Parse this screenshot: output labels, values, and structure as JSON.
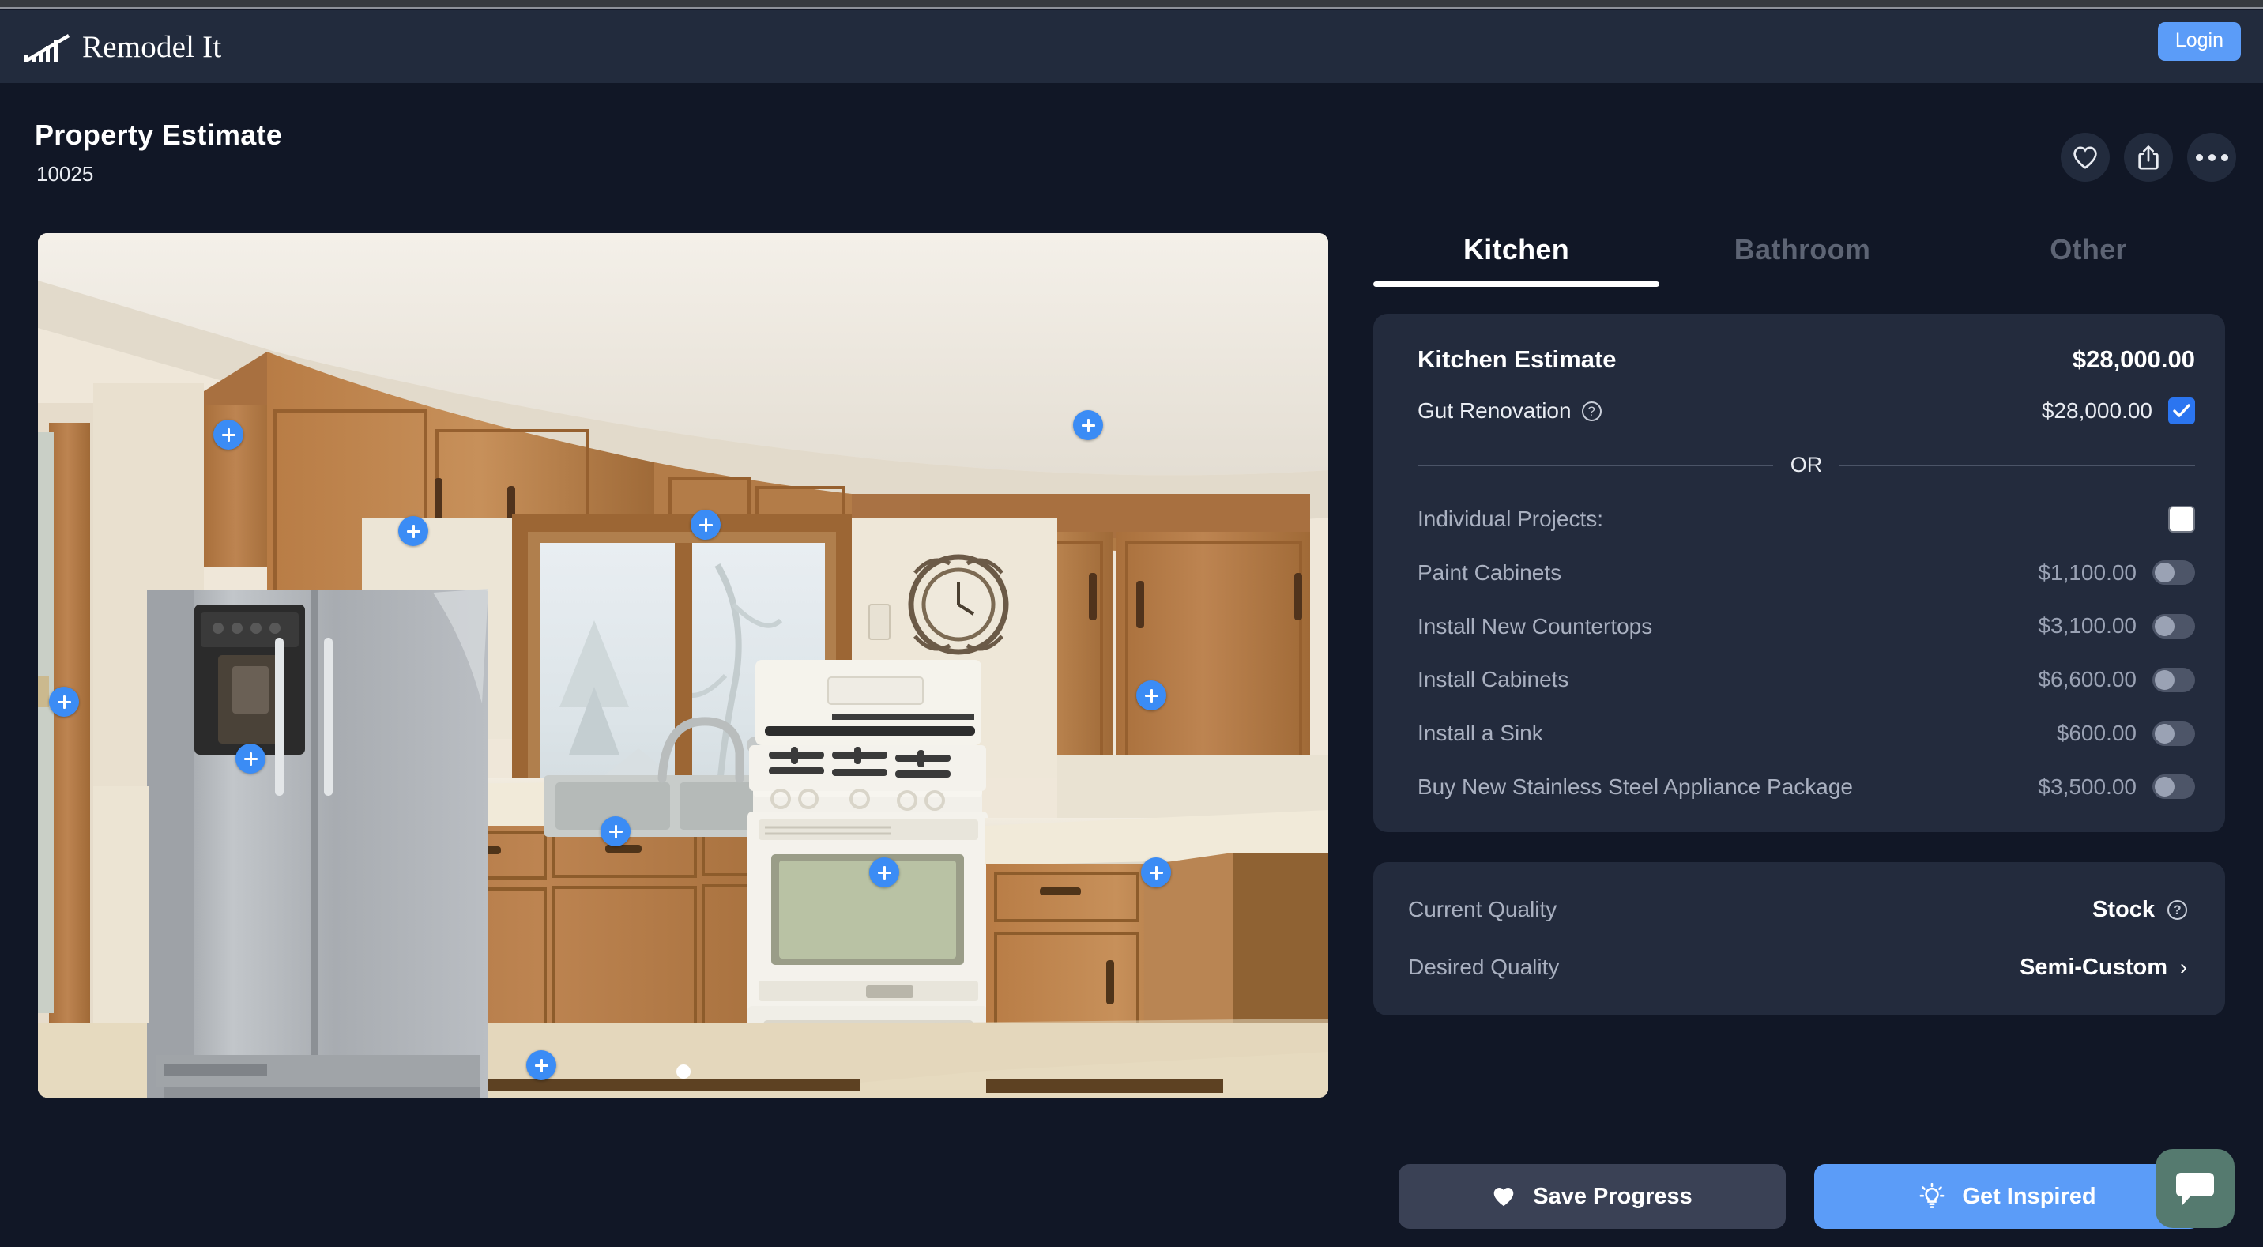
{
  "header": {
    "logo_text": "Remodel It",
    "logo_icon": "bar-chart-trend-icon",
    "login_label": "Login"
  },
  "page": {
    "title": "Property Estimate",
    "subtitle": "10025"
  },
  "actions": [
    {
      "name": "favorite",
      "icon": "heart-icon"
    },
    {
      "name": "share",
      "icon": "share-icon"
    },
    {
      "name": "more",
      "icon": "ellipsis-icon"
    }
  ],
  "photo": {
    "alt": "Kitchen interior with oak cabinets, stainless refrigerator and white gas range",
    "hotspot_count": 10,
    "carousel_dots": 1,
    "current_slide": 1
  },
  "tabs": [
    {
      "label": "Kitchen",
      "active": true
    },
    {
      "label": "Bathroom",
      "active": false
    },
    {
      "label": "Other",
      "active": false
    }
  ],
  "estimate_card": {
    "title": "Kitchen Estimate",
    "total": "$28,000.00",
    "gut": {
      "label": "Gut Renovation",
      "help_glyph": "?",
      "price": "$28,000.00",
      "checked": true
    },
    "or_text": "OR",
    "individual_label": "Individual Projects:",
    "individual_checked": false,
    "projects": [
      {
        "label": "Paint Cabinets",
        "price": "$1,100.00",
        "on": false
      },
      {
        "label": "Install New Countertops",
        "price": "$3,100.00",
        "on": false
      },
      {
        "label": "Install Cabinets",
        "price": "$6,600.00",
        "on": false
      },
      {
        "label": "Install a Sink",
        "price": "$600.00",
        "on": false
      },
      {
        "label": "Buy New Stainless Steel Appliance Package",
        "price": "$3,500.00",
        "on": false
      }
    ]
  },
  "quality_card": {
    "current_label": "Current Quality",
    "current_value": "Stock",
    "current_help_glyph": "?",
    "desired_label": "Desired Quality",
    "desired_value": "Semi-Custom",
    "desired_chevron": "›"
  },
  "bottom": {
    "save_label": "Save Progress",
    "save_icon": "heart-icon",
    "inspire_label": "Get Inspired",
    "inspire_icon": "lightbulb-icon"
  },
  "chat": {
    "icon": "chat-bubble-icon"
  },
  "colors": {
    "page_bg": "#111726",
    "header_bg": "#222b3d",
    "card_bg": "#232b3d",
    "accent_blue": "#5b9cf8",
    "checkbox_blue": "#2b75f0",
    "hotspot_blue": "#3b8cf5",
    "chat_green": "#557a6f",
    "muted_text": "#a9b0c0"
  }
}
